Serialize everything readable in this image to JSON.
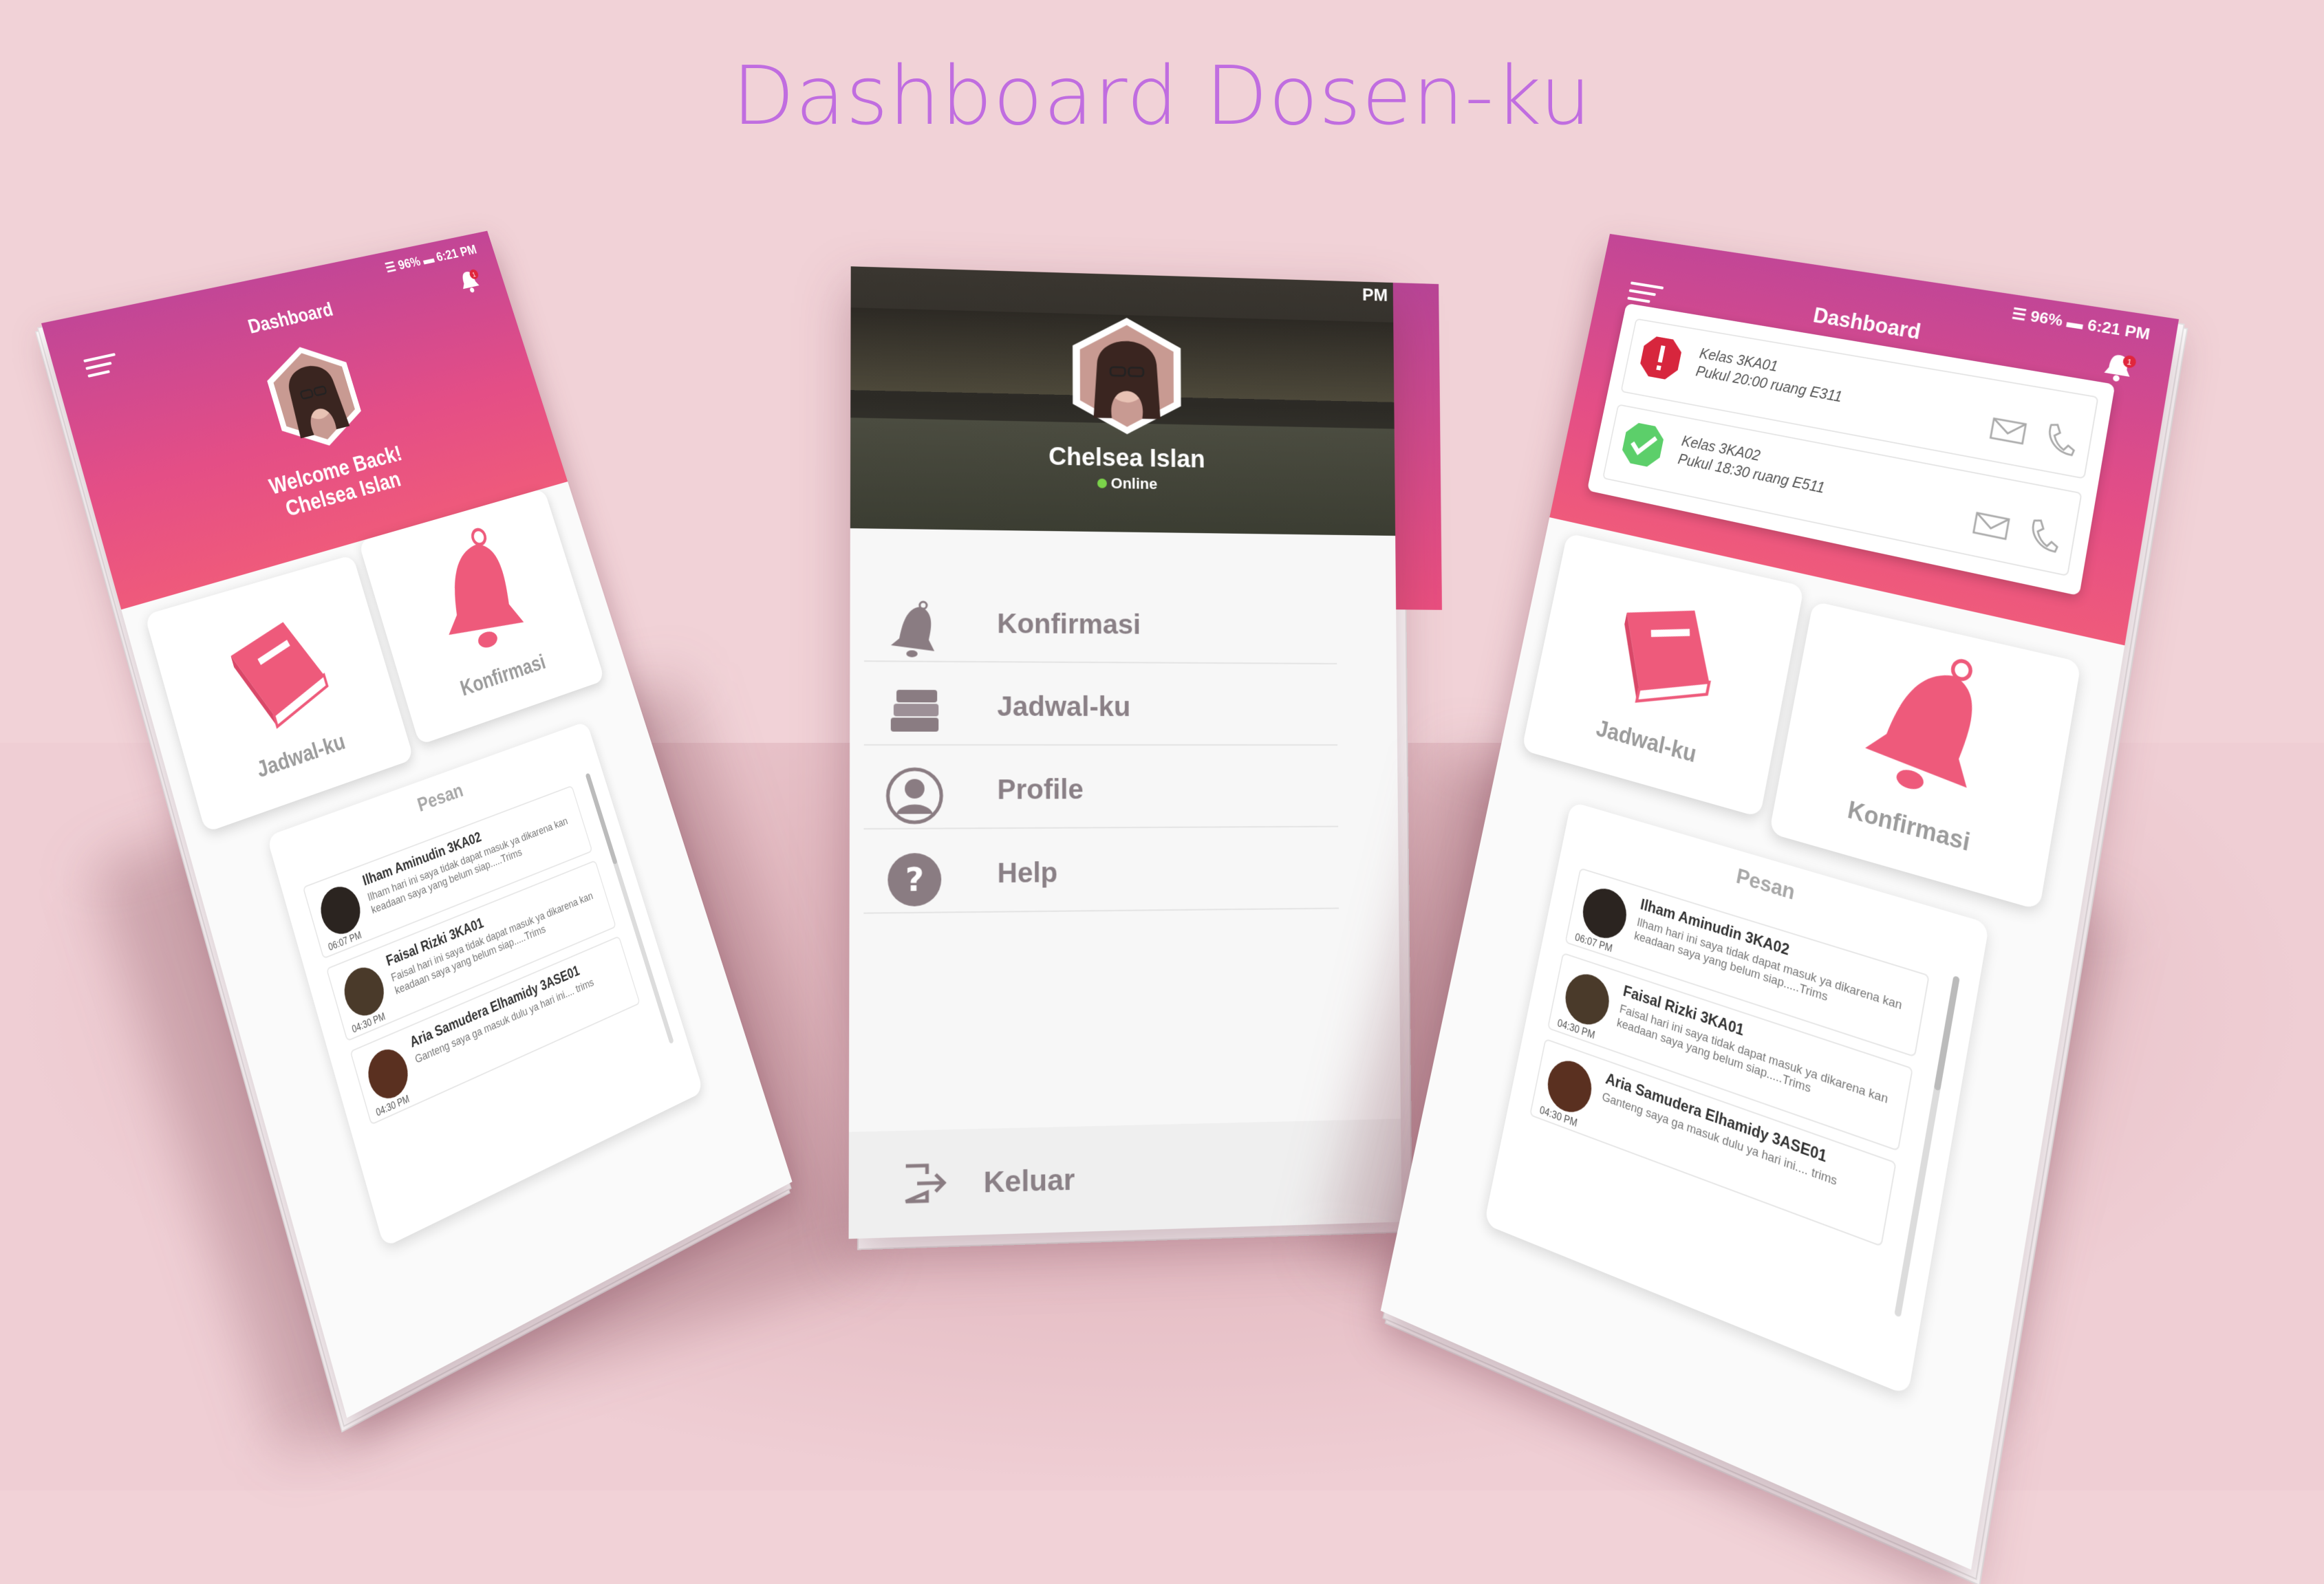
{
  "headline": "Dashboard Dosen-ku",
  "colors": {
    "brand_top": "#c24696",
    "brand_bottom": "#ef5a7b",
    "accent_icon": "#ee5a7b",
    "headline": "#c06de0"
  },
  "status_bar": {
    "battery": "96%",
    "time": "6:21 PM"
  },
  "header": {
    "title": "Dashboard",
    "notification_count": "1"
  },
  "welcome": {
    "line1": "Welcome Back!",
    "line2": "Chelsea Islan"
  },
  "cards": {
    "schedule": "Jadwal-ku",
    "confirm": "Konfirmasi"
  },
  "messages": {
    "title": "Pesan",
    "items": [
      {
        "name": "Ilham Aminudin 3KA02",
        "body": "Ilham hari ini saya tidak dapat masuk ya dikarena kan keadaan saya yang belum siap.....Trims",
        "time": "06:07 PM"
      },
      {
        "name": "Faisal Rizki 3KA01",
        "body": "Faisal hari ini saya tidak dapat masuk ya dikarena kan keadaan saya yang belum siap.....Trims",
        "time": "04:30 PM"
      },
      {
        "name": "Aria Samudera Elhamidy 3ASE01",
        "body": "Ganteng saya ga masuk dulu ya hari ini.... trims",
        "time": "04:30 PM"
      }
    ]
  },
  "drawer": {
    "status_fragment": "PM",
    "profile_name": "Chelsea Islan",
    "profile_status": "Online",
    "menu": [
      {
        "label": "Konfirmasi",
        "icon": "bell-icon"
      },
      {
        "label": "Jadwal-ku",
        "icon": "books-icon"
      },
      {
        "label": "Profile",
        "icon": "user-icon"
      },
      {
        "label": "Help",
        "icon": "help-icon"
      }
    ],
    "logout": "Keluar"
  },
  "notifications": [
    {
      "line1": "Kelas 3KA01",
      "line2": "Pukul 20:00 ruang E311",
      "status": "warning",
      "icon": "alert-icon"
    },
    {
      "line1": "Kelas 3KA02",
      "line2": "Pukul 18:30 ruang E511",
      "status": "success",
      "icon": "check-icon"
    }
  ]
}
